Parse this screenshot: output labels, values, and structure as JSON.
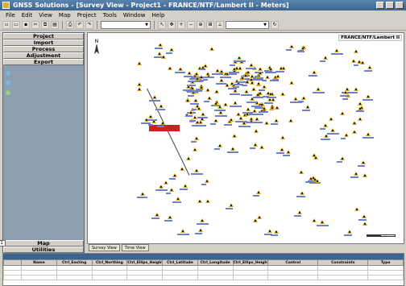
{
  "window": {
    "title": "GNSS Solutions - [Survey View - Project1 - FRANCE/NTF/Lambert II - Meters]"
  },
  "menu": {
    "items": [
      "File",
      "Edit",
      "View",
      "Map",
      "Project",
      "Tools",
      "Window",
      "Help"
    ]
  },
  "sidebar": {
    "sections_top": [
      "Project",
      "Import",
      "Process",
      "Adjustment",
      "Export"
    ],
    "sections_bottom": [
      "Map",
      "Utilities"
    ],
    "page_number": "1"
  },
  "map": {
    "projection_label": "FRANCE/NTF/Lambert II"
  },
  "view_tabs": [
    "Survey View",
    "Time View"
  ],
  "table": {
    "columns": [
      "Name",
      "Ctrl_Easting",
      "Ctrl_Northing",
      "Ctrl_Ellips_Height",
      "Ctrl_Latitude",
      "Ctrl_Longitude",
      "Ctrl_Ellips_Height",
      "Control",
      "Constraints",
      "Type"
    ]
  },
  "colors": {
    "titlebar": "#3b6590",
    "sidebar_bg": "#8c9eb0",
    "point_marker": "#d7a51c",
    "highlight": "#cf2020"
  }
}
